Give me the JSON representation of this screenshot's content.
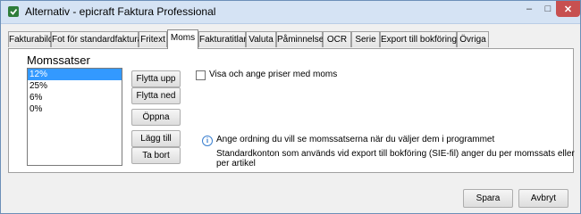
{
  "window": {
    "title": "Alternativ - epicraft Faktura Professional"
  },
  "tabs": [
    {
      "label": "Fakturabild"
    },
    {
      "label": "Fot för standardfaktura"
    },
    {
      "label": "Fritext"
    },
    {
      "label": "Moms",
      "active": true
    },
    {
      "label": "Fakturatitlar"
    },
    {
      "label": "Valuta"
    },
    {
      "label": "Påminnelser"
    },
    {
      "label": "OCR"
    },
    {
      "label": "Serie"
    },
    {
      "label": "Export till bokföring"
    },
    {
      "label": "Övriga"
    }
  ],
  "moms": {
    "group_title": "Momssatser",
    "rates": [
      "12%",
      "25%",
      "6%",
      "0%"
    ],
    "selected_rate": "12%",
    "buttons": {
      "move_up": "Flytta upp",
      "move_down": "Flytta ned",
      "open": "Öppna",
      "add": "Lägg till",
      "remove": "Ta bort"
    },
    "checkbox_label": "Visa och ange priser med moms",
    "checkbox_checked": false,
    "info_line1": "Ange ordning du vill se momssatserna när du väljer dem i programmet",
    "info_line2": "Standardkonton som används vid export till bokföring (SIE-fil) anger du per momssats eller per artikel"
  },
  "footer": {
    "save": "Spara",
    "cancel": "Avbryt"
  },
  "colors": {
    "selection": "#3399ff",
    "close_button": "#c75050",
    "info_icon": "#3a7fcf"
  }
}
